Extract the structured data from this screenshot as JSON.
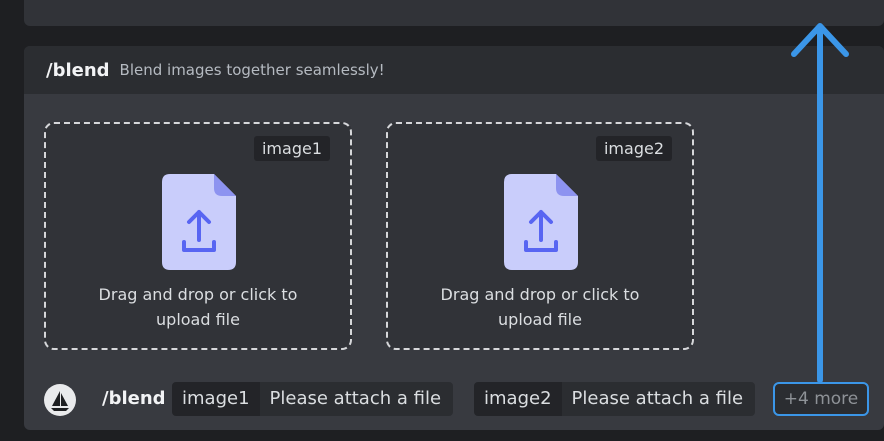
{
  "command": {
    "name": "/blend",
    "description": "Blend images together seamlessly!"
  },
  "dropzones": [
    {
      "tag": "image1",
      "text_line1": "Drag and drop or click to",
      "text_line2": "upload file"
    },
    {
      "tag": "image2",
      "text_line1": "Drag and drop or click to",
      "text_line2": "upload file"
    }
  ],
  "input_bar": {
    "command": "/blend",
    "options": [
      {
        "name": "image1",
        "value": "Please attach a file"
      },
      {
        "name": "image2",
        "value": "Please attach a file"
      }
    ],
    "more_label": "+4 more"
  },
  "colors": {
    "accent_arrow": "#3b96e8",
    "file_icon": "#c9cdfb",
    "upload_glyph": "#5865f2"
  },
  "icons": {
    "file_upload": "file-upload-icon",
    "bot_avatar": "sailboat-avatar-icon",
    "annotation_arrow": "up-arrow-icon"
  }
}
